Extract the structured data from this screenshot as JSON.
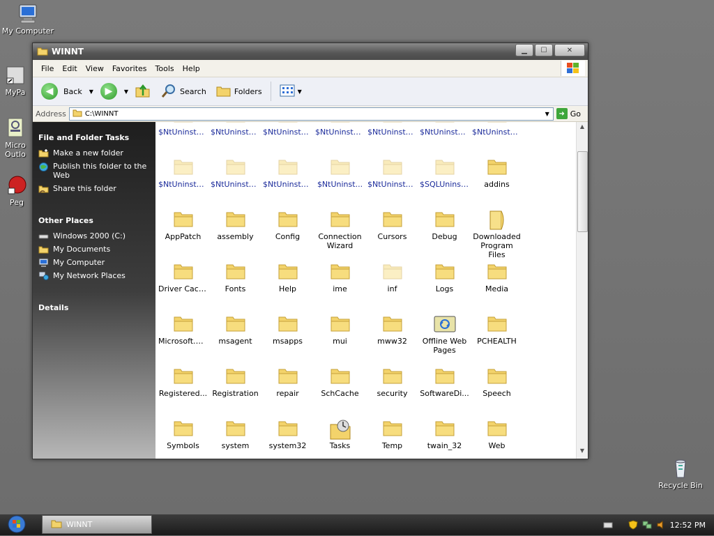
{
  "desktop": {
    "icons": [
      {
        "label": "My Computer",
        "icon": "computer-icon"
      },
      {
        "label": "MyPa",
        "icon": "shortcut-icon"
      },
      {
        "label": "Micro\nOutlo",
        "icon": "outlook-icon"
      },
      {
        "label": "Peg",
        "icon": "shortcut-icon"
      },
      {
        "label": "Recycle Bin",
        "icon": "recycle-bin-icon"
      }
    ]
  },
  "window": {
    "title": "WINNT",
    "menu": [
      "File",
      "Edit",
      "View",
      "Favorites",
      "Tools",
      "Help"
    ],
    "toolbar": {
      "back": "Back",
      "search": "Search",
      "folders": "Folders"
    },
    "address": {
      "label": "Address",
      "value": "C:\\WINNT",
      "go": "Go"
    },
    "left_pane": {
      "file_tasks_title": "File and Folder Tasks",
      "file_tasks": [
        "Make a new folder",
        "Publish this folder to the Web",
        "Share this folder"
      ],
      "other_places_title": "Other Places",
      "other_places": [
        "Windows 2000 (C:)",
        "My Documents",
        "My Computer",
        "My Network Places"
      ],
      "details_title": "Details"
    },
    "items": [
      {
        "name": "$NtUninstal...",
        "hidden": true
      },
      {
        "name": "$NtUninstal...",
        "hidden": true
      },
      {
        "name": "$NtUninstal...",
        "hidden": true
      },
      {
        "name": "$NtUninstal...",
        "hidden": true
      },
      {
        "name": "$NtUninstal...",
        "hidden": true
      },
      {
        "name": "$NtUninstal...",
        "hidden": true
      },
      {
        "name": "$NtUninstal...",
        "hidden": true
      },
      {
        "name": "$NtUninstal...",
        "hidden": true
      },
      {
        "name": "$NtUninstal...",
        "hidden": true
      },
      {
        "name": "$NtUninstal...",
        "hidden": true
      },
      {
        "name": "$NtUninst...",
        "hidden": true
      },
      {
        "name": "$NtUninstal...",
        "hidden": true
      },
      {
        "name": "$SQLUninst...",
        "hidden": true
      },
      {
        "name": "addins",
        "hidden": false
      },
      {
        "name": "AppPatch",
        "hidden": false
      },
      {
        "name": "assembly",
        "hidden": false
      },
      {
        "name": "Config",
        "hidden": false
      },
      {
        "name": "Connection Wizard",
        "hidden": false
      },
      {
        "name": "Cursors",
        "hidden": false
      },
      {
        "name": "Debug",
        "hidden": false
      },
      {
        "name": "Downloaded Program Files",
        "hidden": false
      },
      {
        "name": "Driver Cache",
        "hidden": false
      },
      {
        "name": "Fonts",
        "hidden": false
      },
      {
        "name": "Help",
        "hidden": false
      },
      {
        "name": "ime",
        "hidden": false
      },
      {
        "name": "inf",
        "hidden": true
      },
      {
        "name": "Logs",
        "hidden": false
      },
      {
        "name": "Media",
        "hidden": false
      },
      {
        "name": "Microsoft.NET",
        "hidden": false
      },
      {
        "name": "msagent",
        "hidden": false
      },
      {
        "name": "msapps",
        "hidden": false
      },
      {
        "name": "mui",
        "hidden": false
      },
      {
        "name": "mww32",
        "hidden": false
      },
      {
        "name": "Offline Web Pages",
        "hidden": false
      },
      {
        "name": "PCHEALTH",
        "hidden": false
      },
      {
        "name": "Registered...",
        "hidden": false
      },
      {
        "name": "Registration",
        "hidden": false
      },
      {
        "name": "repair",
        "hidden": false
      },
      {
        "name": "SchCache",
        "hidden": false
      },
      {
        "name": "security",
        "hidden": false
      },
      {
        "name": "SoftwareDi...",
        "hidden": false
      },
      {
        "name": "Speech",
        "hidden": false
      },
      {
        "name": "Symbols",
        "hidden": false
      },
      {
        "name": "system",
        "hidden": false
      },
      {
        "name": "system32",
        "hidden": false
      },
      {
        "name": "Tasks",
        "hidden": false
      },
      {
        "name": "Temp",
        "hidden": false
      },
      {
        "name": "twain_32",
        "hidden": false
      },
      {
        "name": "Web",
        "hidden": false
      }
    ]
  },
  "taskbar": {
    "task_label": "WINNT",
    "clock": "12:52 PM"
  }
}
